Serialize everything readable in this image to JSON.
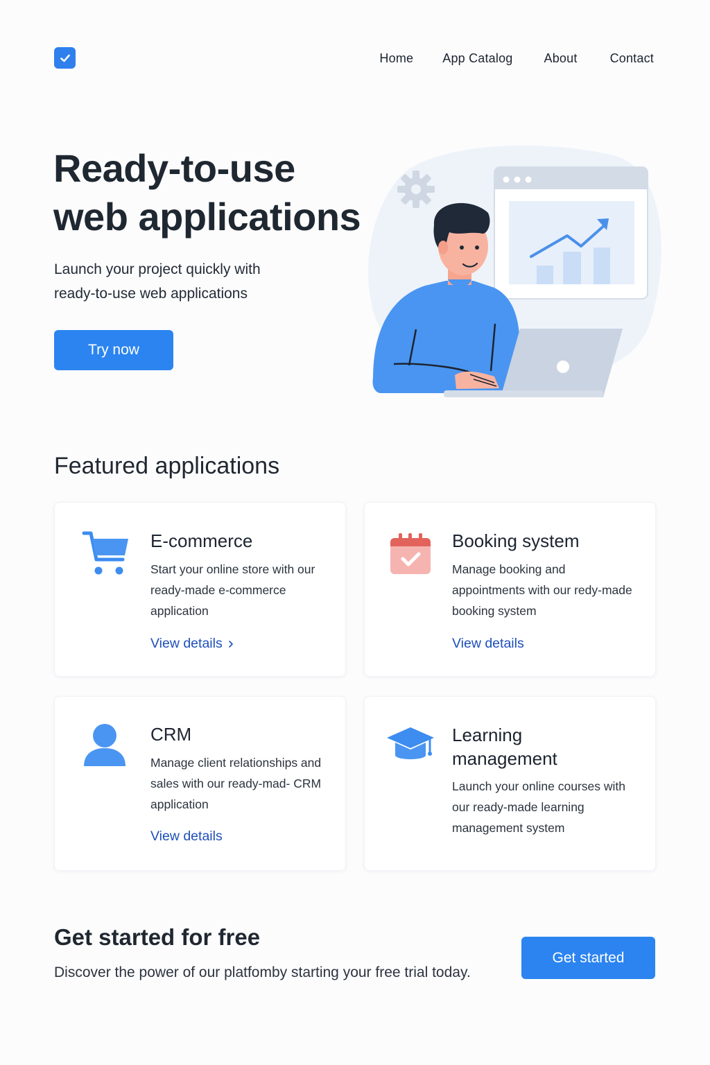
{
  "brand": {
    "logo_icon": "check-icon",
    "accent": "#2b84f0"
  },
  "nav": {
    "home": "Home",
    "catalog": "App Catalog",
    "about": "About",
    "contact": "Contact"
  },
  "hero": {
    "title": "Ready-to-use web applications",
    "subtitle": "Launch your project quickly with ready-to-use web applications",
    "cta": "Try now"
  },
  "featured": {
    "title": "Featured applications",
    "cards": [
      {
        "icon": "cart-icon",
        "title": "E-commerce",
        "desc": "Start your online store with our ready-made e-commerce application",
        "link": "View details"
      },
      {
        "icon": "calendar-icon",
        "title": "Booking system",
        "desc": "Manage booking and appointments with our redy-made booking system",
        "link": "View details"
      },
      {
        "icon": "user-icon",
        "title": "CRM",
        "desc": "Manage client relationships and sales with our ready-mad- CRM application",
        "link": "View details"
      },
      {
        "icon": "graduation-cap-icon",
        "title": "Learning management",
        "desc": "Launch your online courses with our ready-made learning management system"
      }
    ]
  },
  "cta": {
    "title": "Get started for free",
    "subtitle": "Discover the power of our platfomby starting your free trial today.",
    "button": "Get started"
  }
}
